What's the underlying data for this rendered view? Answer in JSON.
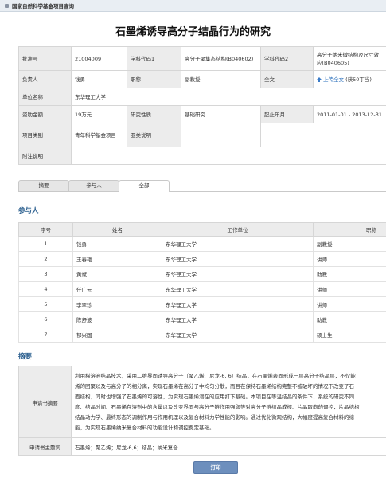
{
  "top_bar": {
    "label": "国家自然科学基金项目查询"
  },
  "title": "石墨烯诱导高分子结晶行为的研究",
  "info": {
    "approval_label": "批准号",
    "approval_value": "21004009",
    "code1_label": "学科代码1",
    "code1_value": "高分子聚集态结构(B040602)",
    "code2_label": "学科代码2",
    "code2_value": "高分子纳米微结构及尺寸效应(B040605)",
    "leader_label": "负责人",
    "leader_value": "钱勇",
    "title_label": "职称",
    "title_value": "副教授",
    "fulltext_label": "全文",
    "fulltext_link": "上传全文",
    "fulltext_reward": "(获50丁当)",
    "org_label": "单位名称",
    "org_value": "东华理工大学",
    "funding_label": "资助金额",
    "funding_value": "19万元",
    "nature_label": "研究性质",
    "nature_value": "基础研究",
    "period_label": "起止年月",
    "period_value": "2011-01-01 - 2013-12-31",
    "category_label": "项目类别",
    "category_value": "青年科学基金项目",
    "subtype_label": "亚类说明",
    "subtype_value": "",
    "note_label": "附注说明",
    "note_value": ""
  },
  "tabs": [
    "摘要",
    "参与人",
    "全部"
  ],
  "participants": {
    "heading": "参与人",
    "columns": [
      "序号",
      "姓名",
      "工作单位",
      "职称"
    ],
    "rows": [
      [
        "1",
        "钱勇",
        "东华理工大学",
        "副教授"
      ],
      [
        "2",
        "王春艳",
        "东华理工大学",
        "讲师"
      ],
      [
        "3",
        "黄斌",
        "东华理工大学",
        "助教"
      ],
      [
        "4",
        "任广元",
        "东华理工大学",
        "讲师"
      ],
      [
        "5",
        "李翠珍",
        "东华理工大学",
        "讲师"
      ],
      [
        "6",
        "陈舒波",
        "东华理工大学",
        "助教"
      ],
      [
        "7",
        "郁兴国",
        "东华理工大学",
        "硕士生"
      ]
    ]
  },
  "abstract": {
    "heading": "摘要",
    "summary_label": "申请书摘要",
    "summary_lines": [
      "利用稀溶液结晶技术，采用二维界面诱导高分子（聚乙烯、尼龙-6, 6）结晶，在石墨烯表面形成一层高分子结晶层，不仅能",
      "烯的团聚以及与高分子的相分离，实现石墨烯在高分子中均匀分散，而且在保持石墨烯结构完整不被破坏的情况下改变了石",
      "面结构，同时也增强了石墨烯的可溶性，为实现石墨烯潜在的应用打下基础。本项目在等温结晶的条件下，系统的研究不同",
      "度、结晶时间、石墨烯在溶剂中的含量以及改变界面与高分子链作用强弱等对高分子链结晶成核、片晶取向的调控，片晶结构",
      "结晶动力学、最终形态的调制作用与作用机理以及复合材料力学性能的影响。通过优化微观结构，大幅度提高复合材料的综",
      "能，为实现石墨烯纳米复合材料的功能设计和调控奠定基础。"
    ],
    "keywords_label": "申请书主题词",
    "keywords_value": "石墨烯；聚乙烯；尼龙-6,6；结晶；纳米复合"
  },
  "print_button": "打印"
}
